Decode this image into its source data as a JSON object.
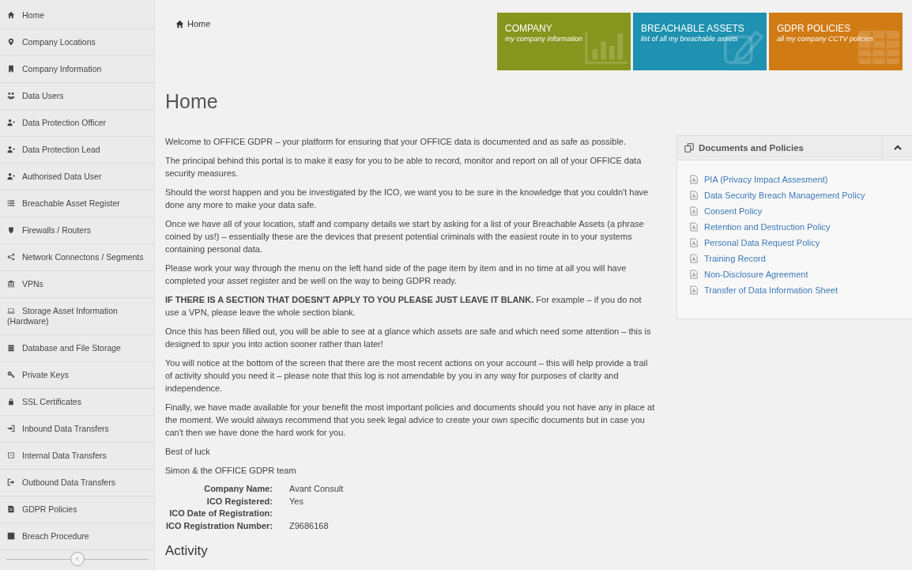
{
  "sidebar": {
    "items": [
      {
        "label": "Home"
      },
      {
        "label": "Company Locations"
      },
      {
        "label": "Company Information"
      },
      {
        "label": "Data Users"
      },
      {
        "label": "Data Protection Officer"
      },
      {
        "label": "Data Protection Lead"
      },
      {
        "label": "Authorised Data User"
      },
      {
        "label": "Breachable Asset Register"
      },
      {
        "label": "Firewalls / Routers"
      },
      {
        "label": "Network Connectons / Segments"
      },
      {
        "label": "VPNs"
      },
      {
        "label": "Storage Asset Information (Hardware)"
      },
      {
        "label": "Database and File Storage"
      },
      {
        "label": "Private Keys"
      },
      {
        "label": "SSL Certificates"
      },
      {
        "label": "Inbound Data Transfers"
      },
      {
        "label": "Internal Data Transfers"
      },
      {
        "label": "Outbound Data Transfers"
      },
      {
        "label": "GDPR Policies"
      },
      {
        "label": "Breach Procedure"
      }
    ]
  },
  "breadcrumb": "Home",
  "tiles": [
    {
      "title": "COMPANY",
      "subtitle": "my company information",
      "color": "#86951d"
    },
    {
      "title": "BREACHABLE ASSETS",
      "subtitle": "list of all my breachable assets",
      "color": "#1e92b0"
    },
    {
      "title": "GDPR POLICIES",
      "subtitle": "all my company CCTV policies",
      "color": "#d07b14"
    }
  ],
  "page_title": "Home",
  "paragraphs": [
    "Welcome to OFFICE GDPR –  your platform for ensuring that your OFFICE data is documented and as safe as possible.",
    "The principal behind this portal is to make it easy for you to be able to record, monitor and report on all of your OFFICE data security measures.",
    "Should the worst happen and you be investigated by the ICO, we want you to be sure in the knowledge that you couldn't have done any more to make your data safe.",
    "Once we have all of your location, staff and company details we start by asking for a list of your Breachable Assets (a phrase coined by us!) – essentially these are the devices that present potential criminals with the easiest route in to your systems containing personal data.",
    "Please work your way through the menu on the left hand side of the page item by item and in no time at all you will have completed your asset register and be well on the way to being GDPR ready.",
    "**IF THERE IS A SECTION THAT DOESN'T APPLY TO YOU PLEASE JUST LEAVE IT BLANK.** For example – if you do not use a VPN, please leave the whole section blank.",
    "Once this has been filled out, you will be able to see at a glance which assets are safe and which need some attention – this is designed to spur you into action sooner rather than later!",
    "You will notice at the bottom of the screen that there are the most recent actions on your account – this will help provide a trail of activity should you need it – please note that this log is not amendable by you in any way for purposes of clarity and independence.",
    "Finally, we have made available for your benefit the most important policies and documents should you not have any in place at the moment. We would always recommend that you seek legal advice to create your own specific documents but in case you can't then we have done the hard work for you.",
    "Best of luck",
    "Simon & the OFFICE GDPR team"
  ],
  "details": [
    {
      "label": "Company Name:",
      "value": "Avant Consult"
    },
    {
      "label": "ICO Registered:",
      "value": "Yes"
    },
    {
      "label": "ICO Date of Registration:"
    },
    {
      "label": "ICO Registration Number:",
      "value": "Z9686168"
    }
  ],
  "activity_heading": "Activity",
  "documents_panel": {
    "title": "Documents and Policies",
    "expanded": true,
    "links": [
      "PIA (Privacy Impact Assesment)",
      "Data Security Breach Management Policy",
      "Consent Policy",
      "Retention and Destruction Policy",
      "Personal Data Request Policy",
      "Training Record",
      "Non-Disclosure Agreement",
      "Transfer of Data Information Sheet"
    ]
  }
}
